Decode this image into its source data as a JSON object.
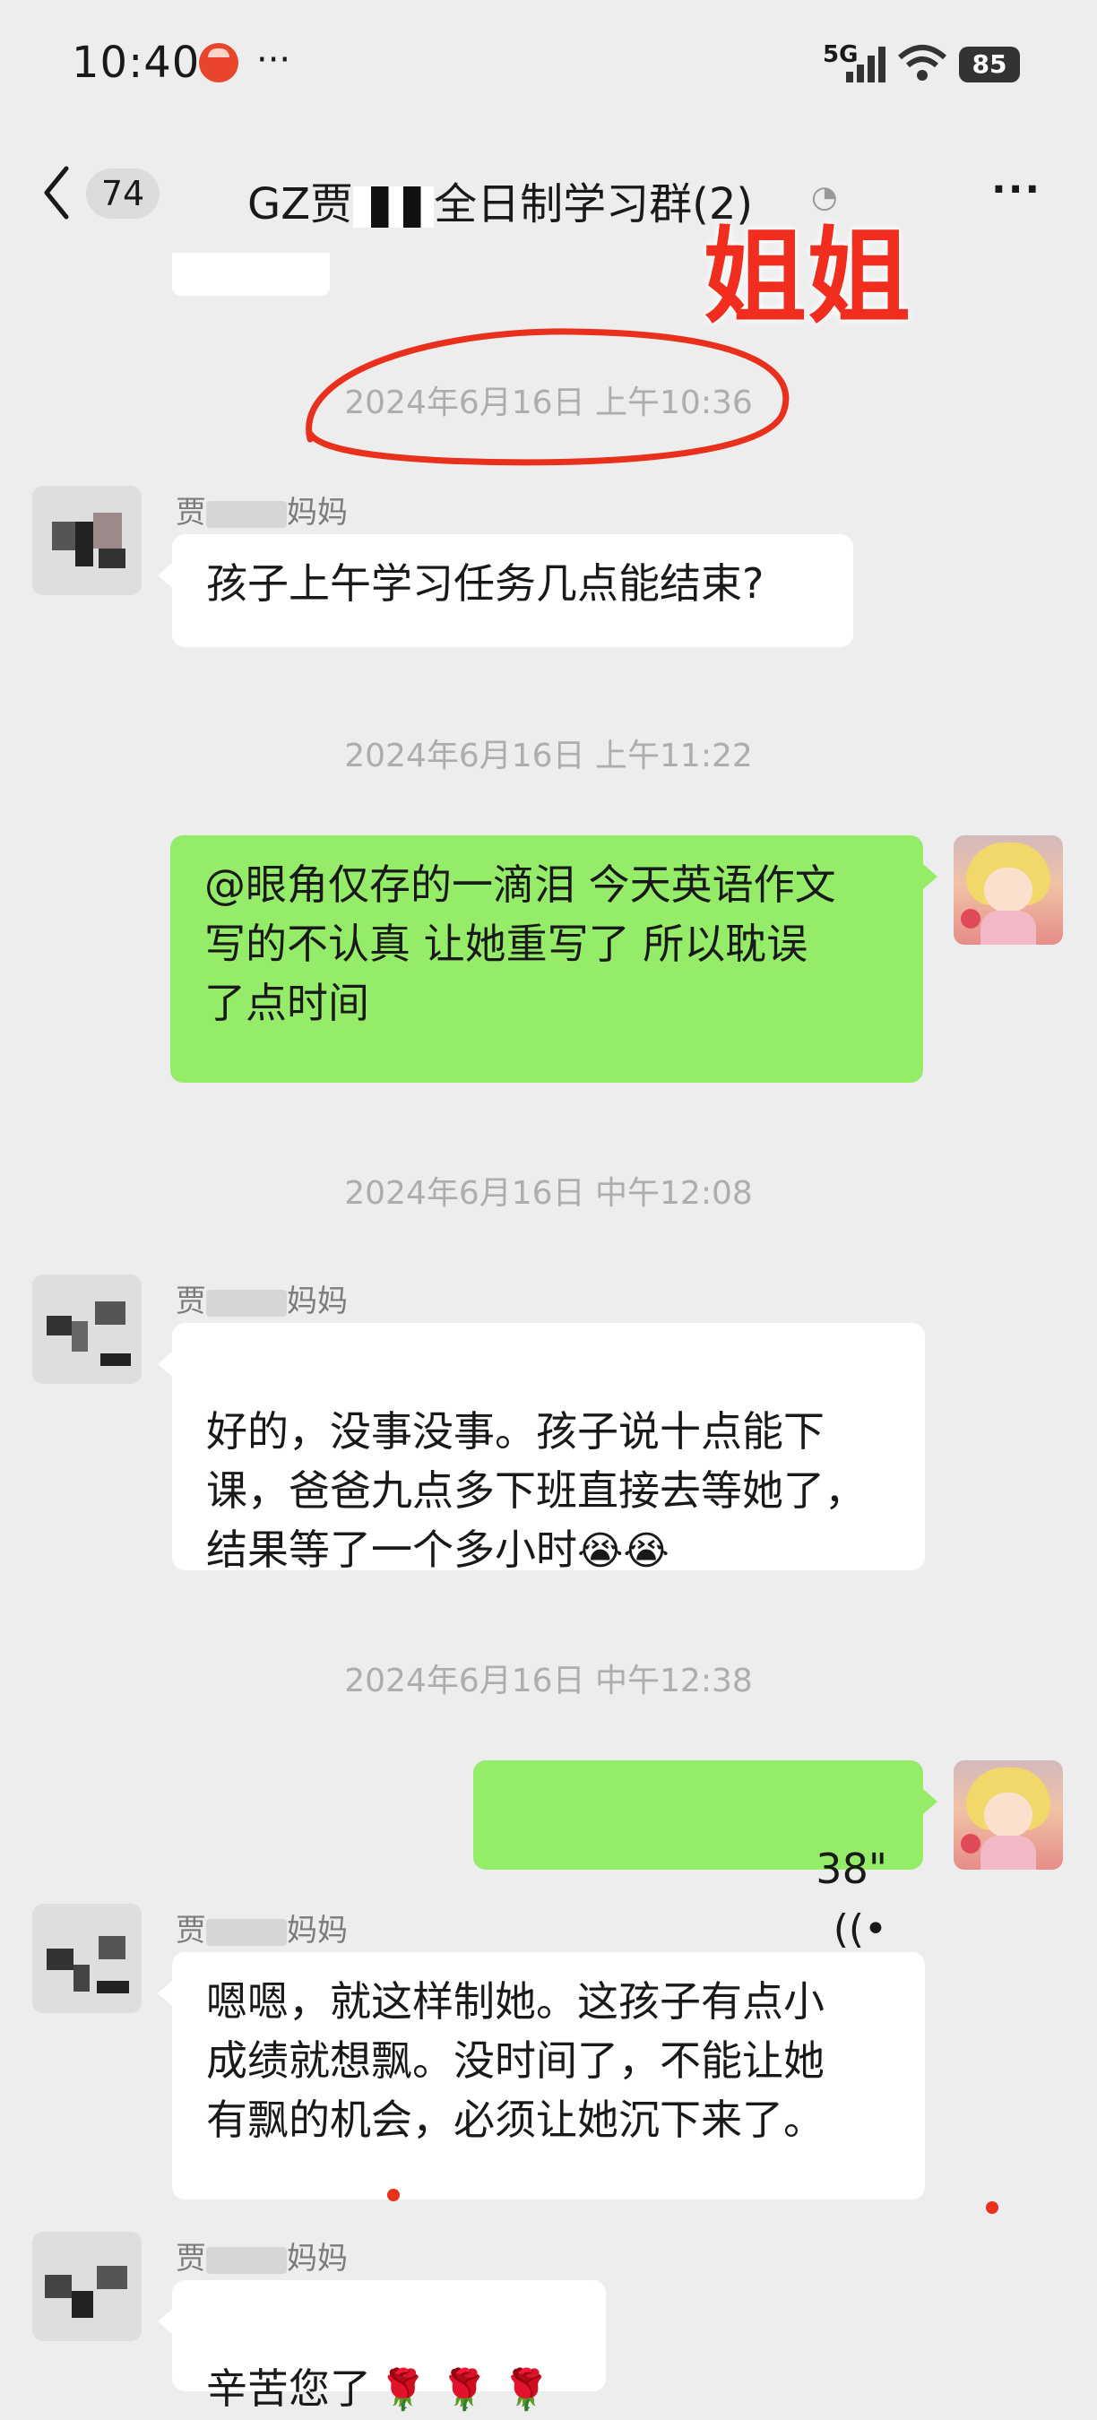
{
  "status_bar": {
    "time": "10:40",
    "app_indicator_icon": "app-notification-icon",
    "more_dots": "···",
    "network": "5G",
    "battery": "85"
  },
  "header": {
    "unread_count": "74",
    "title_prefix": "GZ贾",
    "title_suffix": "全日制学习群(2)",
    "more": "···"
  },
  "annotation": {
    "sticker_text": "姐姐",
    "circle_color": "#e8301d"
  },
  "messages": [
    {
      "type": "timestamp",
      "text": "2024年6月16日 上午10:36"
    },
    {
      "type": "incoming",
      "sender_prefix": "贾",
      "sender_suffix": "妈妈",
      "text": "孩子上午学习任务几点能结束?"
    },
    {
      "type": "timestamp",
      "text": "2024年6月16日 上午11:22"
    },
    {
      "type": "outgoing",
      "text": "@眼角仅存的一滴泪  今天英语作文\n写的不认真 让她重写了 所以耽误\n了点时间"
    },
    {
      "type": "timestamp",
      "text": "2024年6月16日 中午12:08"
    },
    {
      "type": "incoming",
      "sender_prefix": "贾",
      "sender_suffix": "妈妈",
      "text": "好的，没事没事。孩子说十点能下\n课，爸爸九点多下班直接去等她了，\n结果等了一个多小时",
      "emoji": "😭😭"
    },
    {
      "type": "timestamp",
      "text": "2024年6月16日 中午12:38"
    },
    {
      "type": "outgoing-voice",
      "duration": "38\""
    },
    {
      "type": "incoming",
      "sender_prefix": "贾",
      "sender_suffix": "妈妈",
      "text": "嗯嗯，就这样制她。这孩子有点小\n成绩就想飘。没时间了，不能让她\n有飘的机会，必须让她沉下来了。"
    },
    {
      "type": "incoming",
      "sender_prefix": "贾",
      "sender_suffix": "妈妈",
      "text": "辛苦您了",
      "emoji": "🌹 🌹 🌹"
    }
  ],
  "colors": {
    "background": "#ededed",
    "outgoing_bubble": "#95ec69",
    "incoming_bubble": "#ffffff",
    "timestamp_text": "#adadad"
  }
}
